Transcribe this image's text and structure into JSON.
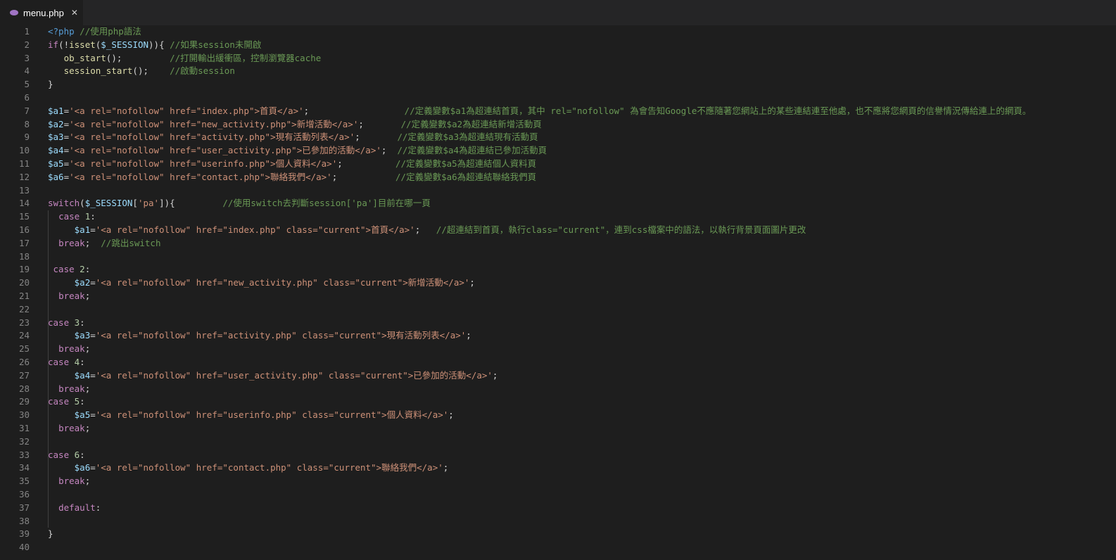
{
  "tab": {
    "label": "menu.php",
    "icon": "php-elephant-icon",
    "close": "✕"
  },
  "lines": [
    [
      [
        "tag",
        "<?php"
      ],
      [
        "plain",
        " "
      ],
      [
        "cmt",
        "//使用php語法"
      ]
    ],
    [
      [
        "kw",
        "if"
      ],
      [
        "plain",
        "(!"
      ],
      [
        "fn",
        "isset"
      ],
      [
        "plain",
        "("
      ],
      [
        "var",
        "$_SESSION"
      ],
      [
        "plain",
        ")){ "
      ],
      [
        "cmt",
        "//如果session未開啟"
      ]
    ],
    [
      [
        "plain",
        "   "
      ],
      [
        "fn",
        "ob_start"
      ],
      [
        "plain",
        "();         "
      ],
      [
        "cmt",
        "//打開輸出緩衝區，控制瀏覽器cache"
      ]
    ],
    [
      [
        "plain",
        "   "
      ],
      [
        "fn",
        "session_start"
      ],
      [
        "plain",
        "();    "
      ],
      [
        "cmt",
        "//啟動session"
      ]
    ],
    [
      [
        "plain",
        "}"
      ]
    ],
    [],
    [
      [
        "var",
        "$a1"
      ],
      [
        "plain",
        "="
      ],
      [
        "str",
        "'<a rel=\"nofollow\" href=\"index.php\">首頁</a>'"
      ],
      [
        "plain",
        ";                  "
      ],
      [
        "cmt",
        "//定義變數$a1為超連結首頁，其中 rel=\"nofollow\" 為會告知Google不應隨著您網站上的某些連結連至他處，也不應將您網頁的信譽情況傳給連上的網頁。"
      ]
    ],
    [
      [
        "var",
        "$a2"
      ],
      [
        "plain",
        "="
      ],
      [
        "str",
        "'<a rel=\"nofollow\" href=\"new_activity.php\">新增活動</a>'"
      ],
      [
        "plain",
        ";       "
      ],
      [
        "cmt",
        "//定義變數$a2為超連結新增活動頁"
      ]
    ],
    [
      [
        "var",
        "$a3"
      ],
      [
        "plain",
        "="
      ],
      [
        "str",
        "'<a rel=\"nofollow\" href=\"activity.php\">現有活動列表</a>'"
      ],
      [
        "plain",
        ";       "
      ],
      [
        "cmt",
        "//定義變數$a3為超連結現有活動頁"
      ]
    ],
    [
      [
        "var",
        "$a4"
      ],
      [
        "plain",
        "="
      ],
      [
        "str",
        "'<a rel=\"nofollow\" href=\"user_activity.php\">已參加的活動</a>'"
      ],
      [
        "plain",
        ";  "
      ],
      [
        "cmt",
        "//定義變數$a4為超連結已參加活動頁"
      ]
    ],
    [
      [
        "var",
        "$a5"
      ],
      [
        "plain",
        "="
      ],
      [
        "str",
        "'<a rel=\"nofollow\" href=\"userinfo.php\">個人資料</a>'"
      ],
      [
        "plain",
        ";          "
      ],
      [
        "cmt",
        "//定義變數$a5為超連結個人資料頁"
      ]
    ],
    [
      [
        "var",
        "$a6"
      ],
      [
        "plain",
        "="
      ],
      [
        "str",
        "'<a rel=\"nofollow\" href=\"contact.php\">聯絡我們</a>'"
      ],
      [
        "plain",
        ";           "
      ],
      [
        "cmt",
        "//定義變數$a6為超連結聯絡我們頁"
      ]
    ],
    [],
    [
      [
        "kw",
        "switch"
      ],
      [
        "plain",
        "("
      ],
      [
        "var",
        "$_SESSION"
      ],
      [
        "plain",
        "["
      ],
      [
        "str",
        "'pa'"
      ],
      [
        "plain",
        "]){         "
      ],
      [
        "cmt",
        "//使用switch去判斷session['pa']目前在哪一頁"
      ]
    ],
    [
      [
        "plain",
        "  "
      ],
      [
        "kw",
        "case"
      ],
      [
        "plain",
        " "
      ],
      [
        "num",
        "1"
      ],
      [
        "plain",
        ":"
      ]
    ],
    [
      [
        "plain",
        "     "
      ],
      [
        "var",
        "$a1"
      ],
      [
        "plain",
        "="
      ],
      [
        "str",
        "'<a rel=\"nofollow\" href=\"index.php\" class=\"current\">首頁</a>'"
      ],
      [
        "plain",
        ";   "
      ],
      [
        "cmt",
        "//超連結到首頁，執行class=\"current\"，連到css檔案中的語法，以執行背景頁面圖片更改"
      ]
    ],
    [
      [
        "plain",
        "  "
      ],
      [
        "kw",
        "break"
      ],
      [
        "plain",
        ";  "
      ],
      [
        "cmt",
        "//跳出switch"
      ]
    ],
    [],
    [
      [
        "plain",
        " "
      ],
      [
        "kw",
        "case"
      ],
      [
        "plain",
        " "
      ],
      [
        "num",
        "2"
      ],
      [
        "plain",
        ":"
      ]
    ],
    [
      [
        "plain",
        "     "
      ],
      [
        "var",
        "$a2"
      ],
      [
        "plain",
        "="
      ],
      [
        "str",
        "'<a rel=\"nofollow\" href=\"new_activity.php\" class=\"current\">新增活動</a>'"
      ],
      [
        "plain",
        ";"
      ]
    ],
    [
      [
        "plain",
        "  "
      ],
      [
        "kw",
        "break"
      ],
      [
        "plain",
        ";"
      ]
    ],
    [],
    [
      [
        "kw",
        "case"
      ],
      [
        "plain",
        " "
      ],
      [
        "num",
        "3"
      ],
      [
        "plain",
        ":"
      ]
    ],
    [
      [
        "plain",
        "     "
      ],
      [
        "var",
        "$a3"
      ],
      [
        "plain",
        "="
      ],
      [
        "str",
        "'<a rel=\"nofollow\" href=\"activity.php\" class=\"current\">現有活動列表</a>'"
      ],
      [
        "plain",
        ";"
      ]
    ],
    [
      [
        "plain",
        "  "
      ],
      [
        "kw",
        "break"
      ],
      [
        "plain",
        ";"
      ]
    ],
    [
      [
        "kw",
        "case"
      ],
      [
        "plain",
        " "
      ],
      [
        "num",
        "4"
      ],
      [
        "plain",
        ":"
      ]
    ],
    [
      [
        "plain",
        "     "
      ],
      [
        "var",
        "$a4"
      ],
      [
        "plain",
        "="
      ],
      [
        "str",
        "'<a rel=\"nofollow\" href=\"user_activity.php\" class=\"current\">已參加的活動</a>'"
      ],
      [
        "plain",
        ";"
      ]
    ],
    [
      [
        "plain",
        "  "
      ],
      [
        "kw",
        "break"
      ],
      [
        "plain",
        ";"
      ]
    ],
    [
      [
        "kw",
        "case"
      ],
      [
        "plain",
        " "
      ],
      [
        "num",
        "5"
      ],
      [
        "plain",
        ":"
      ]
    ],
    [
      [
        "plain",
        "     "
      ],
      [
        "var",
        "$a5"
      ],
      [
        "plain",
        "="
      ],
      [
        "str",
        "'<a rel=\"nofollow\" href=\"userinfo.php\" class=\"current\">個人資料</a>'"
      ],
      [
        "plain",
        ";"
      ]
    ],
    [
      [
        "plain",
        "  "
      ],
      [
        "kw",
        "break"
      ],
      [
        "plain",
        ";"
      ]
    ],
    [],
    [
      [
        "kw",
        "case"
      ],
      [
        "plain",
        " "
      ],
      [
        "num",
        "6"
      ],
      [
        "plain",
        ":"
      ]
    ],
    [
      [
        "plain",
        "     "
      ],
      [
        "var",
        "$a6"
      ],
      [
        "plain",
        "="
      ],
      [
        "str",
        "'<a rel=\"nofollow\" href=\"contact.php\" class=\"current\">聯絡我們</a>'"
      ],
      [
        "plain",
        ";"
      ]
    ],
    [
      [
        "plain",
        "  "
      ],
      [
        "kw",
        "break"
      ],
      [
        "plain",
        ";"
      ]
    ],
    [],
    [
      [
        "plain",
        "  "
      ],
      [
        "kw",
        "default"
      ],
      [
        "plain",
        ":"
      ]
    ],
    [],
    [
      [
        "plain",
        "}"
      ]
    ],
    []
  ]
}
